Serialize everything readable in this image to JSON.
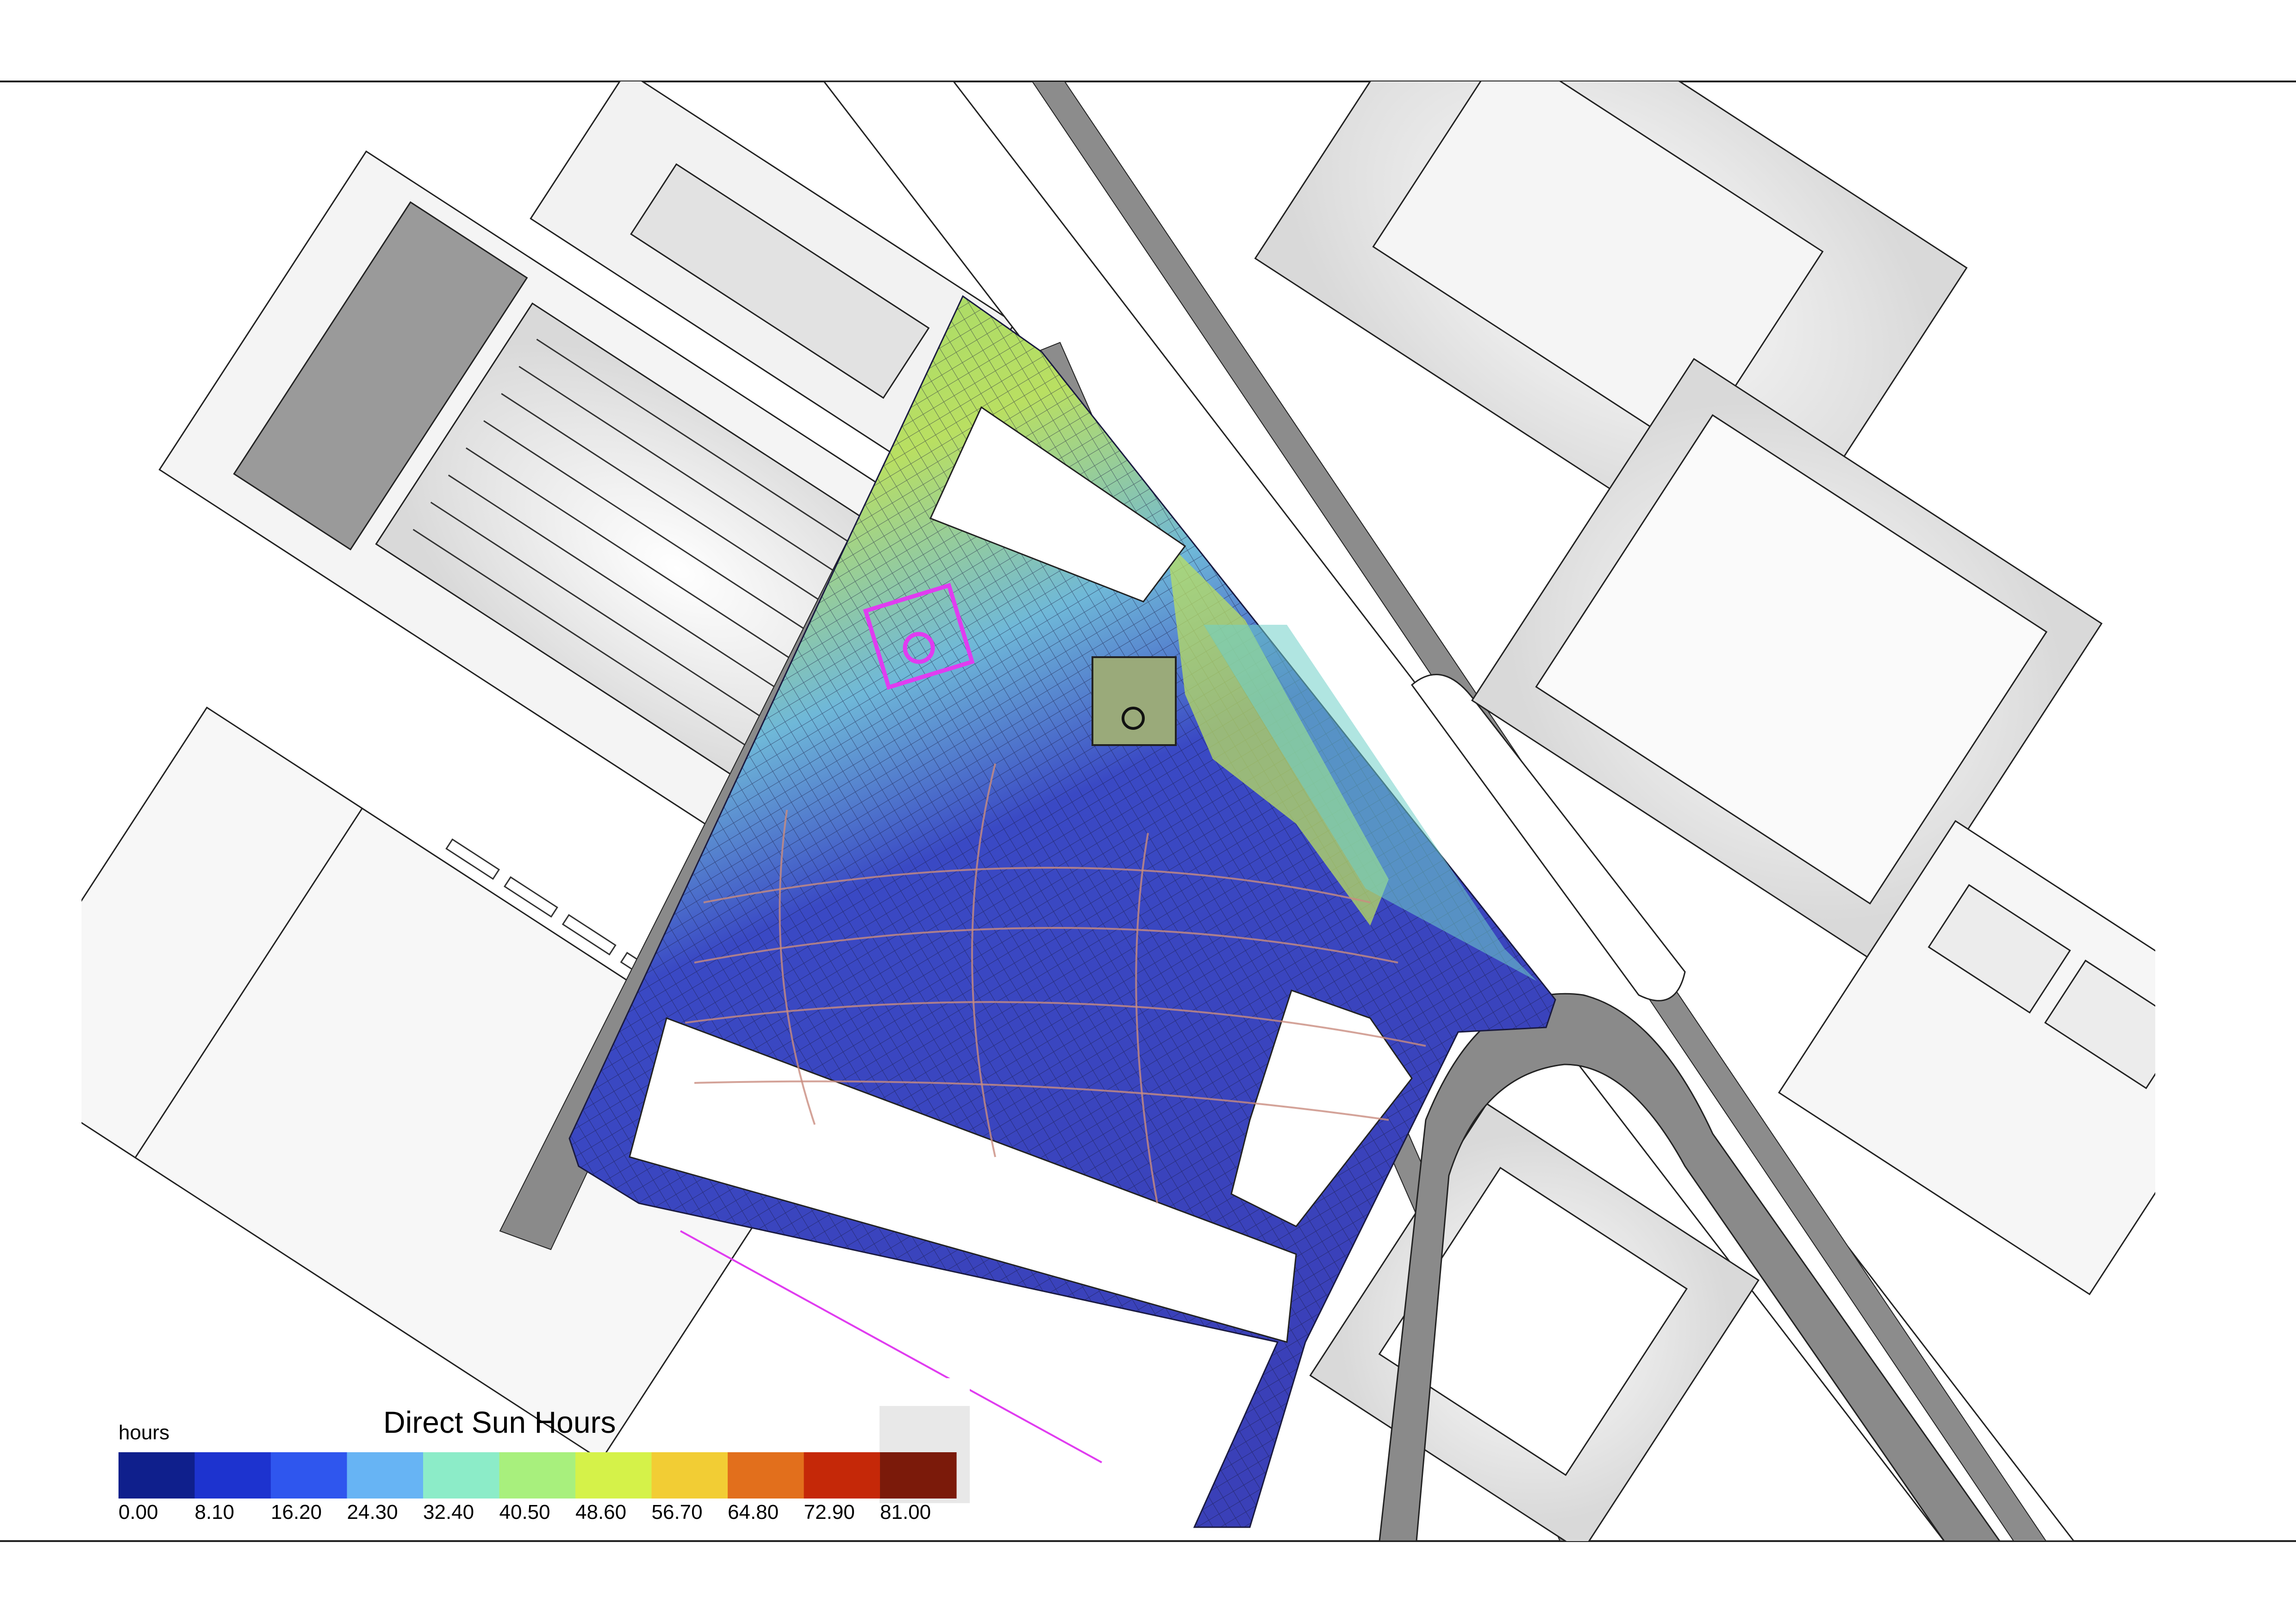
{
  "legend": {
    "title": "Direct Sun Hours",
    "unit": "hours",
    "ticks": [
      "0.00",
      "8.10",
      "16.20",
      "24.30",
      "32.40",
      "40.50",
      "48.60",
      "56.70",
      "64.80",
      "72.90",
      "81.00"
    ],
    "colors": [
      "#0f1f8c",
      "#1d33cf",
      "#2f56ee",
      "#67b4f4",
      "#8cecc8",
      "#a8f07d",
      "#d5f249",
      "#f2cd34",
      "#e26f1c",
      "#c52808",
      "#7b1a0a"
    ]
  },
  "analysis_grid_colors": {
    "low": "#3a49c4",
    "mid": "#6fb8d8",
    "high": "#cfe46a"
  },
  "highlight_color": "#e03cf0"
}
